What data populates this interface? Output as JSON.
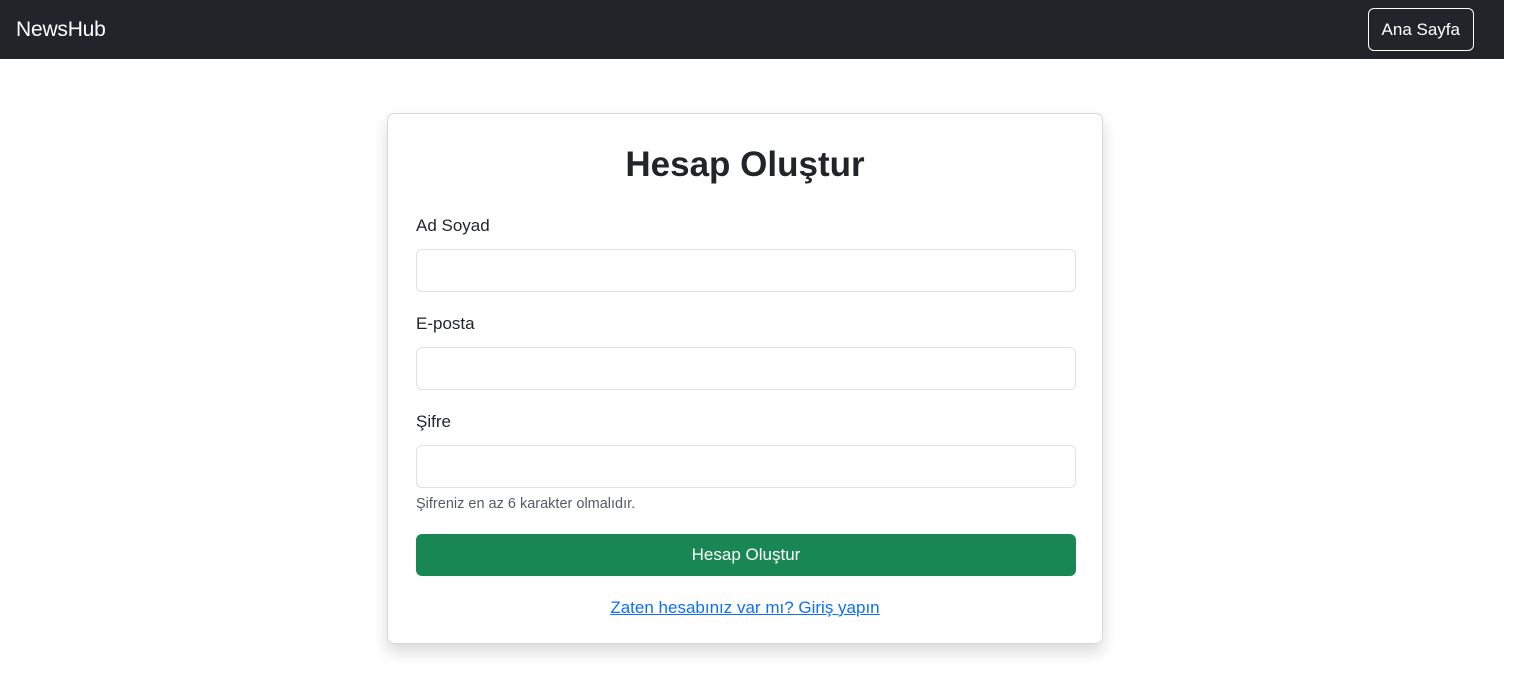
{
  "navbar": {
    "brand": "NewsHub",
    "home_button": "Ana Sayfa"
  },
  "form": {
    "title": "Hesap Oluştur",
    "fields": [
      {
        "label": "Ad Soyad",
        "value": "",
        "placeholder": ""
      },
      {
        "label": "E-posta",
        "value": "",
        "placeholder": ""
      },
      {
        "label": "Şifre",
        "value": "",
        "placeholder": ""
      }
    ],
    "password_help": "Şifreniz en az 6 karakter olmalıdır.",
    "submit_label": "Hesap Oluştur",
    "login_link": "Zaten hesabınız var mı? Giriş yapın"
  },
  "colors": {
    "navbar_bg": "#212529",
    "submit_bg": "#198754",
    "link": "#0d6efd"
  }
}
